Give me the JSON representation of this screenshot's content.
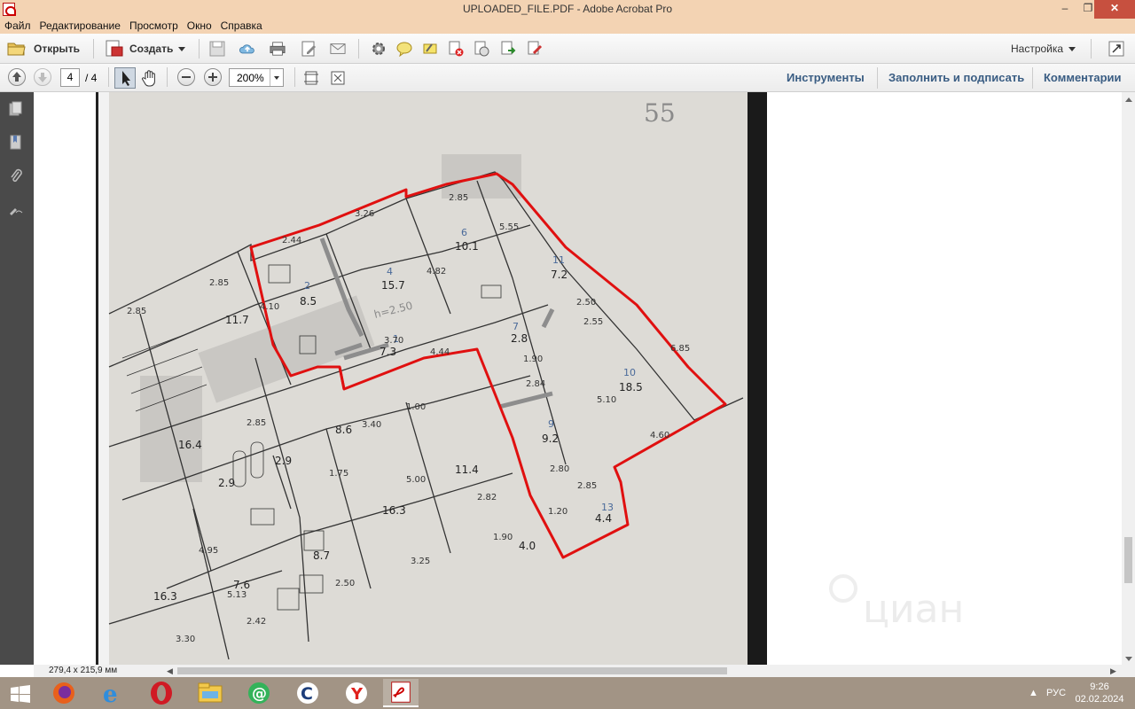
{
  "window": {
    "title": "UPLOADED_FILE.PDF - Adobe Acrobat Pro"
  },
  "menu": [
    "Файл",
    "Редактирование",
    "Просмотр",
    "Окно",
    "Справка"
  ],
  "toolbar": {
    "open_label": "Открыть",
    "create_label": "Создать",
    "settings_label": "Настройка"
  },
  "nav": {
    "current_page": "4",
    "total_pages": "/ 4",
    "zoom": "200%"
  },
  "right_links": {
    "tools": "Инструменты",
    "fill_sign": "Заполнить и подписать",
    "comments": "Комментарии"
  },
  "status": {
    "page_size": "279,4 x 215,9 мм"
  },
  "document": {
    "page_mark": "55",
    "rooms": [
      {
        "num": "1",
        "area": "7.3"
      },
      {
        "num": "2",
        "area": "8.5"
      },
      {
        "num": "4",
        "area": "15.7"
      },
      {
        "num": "6",
        "area": "10.1"
      },
      {
        "num": "7",
        "area": "2.8"
      },
      {
        "num": "9",
        "area": "9.2"
      },
      {
        "num": "10",
        "area": "18.5"
      },
      {
        "num": "11",
        "area": "7.2"
      },
      {
        "num": "13",
        "area": "4.4"
      },
      {
        "num": "3",
        "area": "11.7"
      },
      {
        "num": "3",
        "area": "16.4"
      },
      {
        "num": "4",
        "area": "16.3"
      },
      {
        "num": "5",
        "area": "11.4"
      },
      {
        "num": "12",
        "area": "4.0"
      },
      {
        "num": "5",
        "area": "16.3"
      },
      {
        "num": "4",
        "area": "7.6"
      },
      {
        "num": "6",
        "area": "8.7"
      },
      {
        "num": "1",
        "area": "8.6"
      },
      {
        "num": "3",
        "area": "2.9"
      },
      {
        "num": "2",
        "area": "2.9"
      }
    ],
    "height_note": "h=2.50",
    "dims": [
      "3.26",
      "2.85",
      "2.44",
      "4.82",
      "5.55",
      "2.50",
      "2.55",
      "1.90",
      "2.84",
      "4.60",
      "2.80",
      "2.85",
      "1.20",
      "1.90",
      "3.70",
      "4.44",
      "2.85",
      "3.40",
      "1.00",
      "5.00",
      "3.25",
      "2.82",
      "2.42",
      "3.30",
      "2.50",
      "4.95",
      "5.13",
      "1.75",
      "5.10",
      "2.85",
      "6.85",
      "4.10",
      "2.85"
    ],
    "watermark": "циан"
  },
  "taskbar": {
    "lang": "РУС",
    "time": "9:26",
    "date": "02.02.2024"
  },
  "colors": {
    "titlebar": "#f3d3b3",
    "taskbar": "#a29485",
    "plan_outline": "#e01010",
    "paper": "#dcdad6"
  }
}
